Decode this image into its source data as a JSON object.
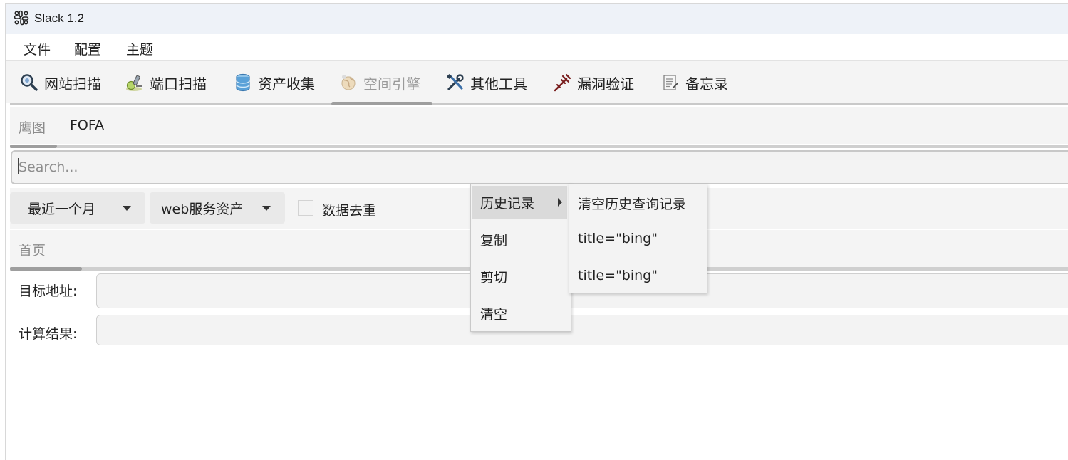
{
  "window": {
    "title": "Slack 1.2"
  },
  "menubar": {
    "items": [
      "文件",
      "配置",
      "主题"
    ]
  },
  "toolbar": {
    "tools": [
      {
        "label": "网站扫描",
        "icon": "magnifier-icon",
        "enabled": true
      },
      {
        "label": "端口扫描",
        "icon": "microscope-icon",
        "enabled": true
      },
      {
        "label": "资产收集",
        "icon": "database-icon",
        "enabled": true
      },
      {
        "label": "空间引擎",
        "icon": "globe-icon",
        "enabled": false
      },
      {
        "label": "其他工具",
        "icon": "tools-icon",
        "enabled": true
      },
      {
        "label": "漏洞验证",
        "icon": "trident-icon",
        "enabled": true
      },
      {
        "label": "备忘录",
        "icon": "notepad-icon",
        "enabled": true
      }
    ]
  },
  "subtabs": [
    "鹰图",
    "FOFA"
  ],
  "search": {
    "placeholder": "Search..."
  },
  "filters": {
    "time_range": "最近一个月",
    "asset_type": "web服务资产",
    "dedupe_label": "数据去重",
    "dedupe_checked": false
  },
  "results_tab": {
    "label": "首页"
  },
  "form": {
    "target_label": "目标地址:",
    "result_label": "计算结果:"
  },
  "context_menu": {
    "items": [
      "历史记录",
      "复制",
      "剪切",
      "清空"
    ],
    "active_item": "历史记录",
    "submenu": {
      "clear_label": "清空历史查询记录",
      "history": [
        "title=\"bing\"",
        "title=\"bing\""
      ]
    }
  }
}
